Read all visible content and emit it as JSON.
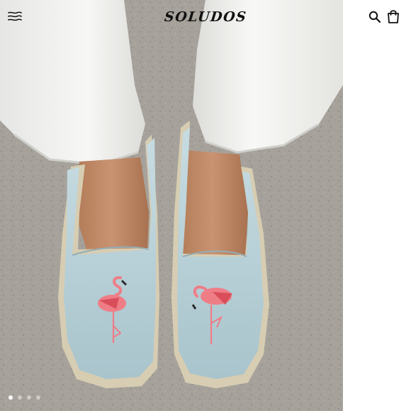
{
  "header": {
    "brand": "SOLUDOS",
    "menu_icon": "hamburger-menu-icon",
    "search_icon": "search-icon",
    "bag_icon": "shopping-bag-icon"
  },
  "product_image": {
    "subject": "flamingo-espadrilles-photo"
  },
  "carousel": {
    "slide_count": 4,
    "active_index": 0
  },
  "colors": {
    "background": "#ffffff",
    "text": "#111111",
    "shoe": "#b9d3db",
    "flamingo": "#ef7d86"
  }
}
